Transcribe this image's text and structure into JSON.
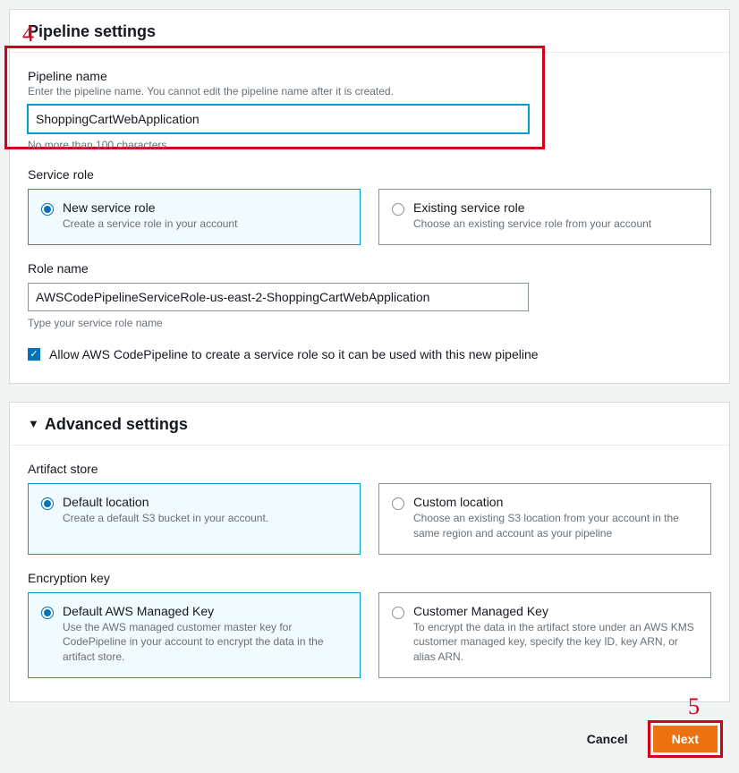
{
  "annotations": {
    "step4": "4",
    "step5": "5"
  },
  "panel_settings": {
    "title": "Pipeline settings",
    "pipeline_name": {
      "label": "Pipeline name",
      "description": "Enter the pipeline name. You cannot edit the pipeline name after it is created.",
      "value": "ShoppingCartWebApplication",
      "hint": "No more than 100 characters"
    },
    "service_role": {
      "label": "Service role",
      "options": [
        {
          "title": "New service role",
          "desc": "Create a service role in your account",
          "selected": true
        },
        {
          "title": "Existing service role",
          "desc": "Choose an existing service role from your account",
          "selected": false
        }
      ]
    },
    "role_name": {
      "label": "Role name",
      "value": "AWSCodePipelineServiceRole-us-east-2-ShoppingCartWebApplication",
      "hint": "Type your service role name"
    },
    "allow_create": {
      "checked": true,
      "label": "Allow AWS CodePipeline to create a service role so it can be used with this new pipeline"
    }
  },
  "panel_advanced": {
    "title": "Advanced settings",
    "artifact_store": {
      "label": "Artifact store",
      "options": [
        {
          "title": "Default location",
          "desc": "Create a default S3 bucket in your account.",
          "selected": true
        },
        {
          "title": "Custom location",
          "desc": "Choose an existing S3 location from your account in the same region and account as your pipeline",
          "selected": false
        }
      ]
    },
    "encryption_key": {
      "label": "Encryption key",
      "options": [
        {
          "title": "Default AWS Managed Key",
          "desc": "Use the AWS managed customer master key for CodePipeline in your account to encrypt the data in the artifact store.",
          "selected": true
        },
        {
          "title": "Customer Managed Key",
          "desc": "To encrypt the data in the artifact store under an AWS KMS customer managed key, specify the key ID, key ARN, or alias ARN.",
          "selected": false
        }
      ]
    }
  },
  "footer": {
    "cancel": "Cancel",
    "next": "Next"
  }
}
